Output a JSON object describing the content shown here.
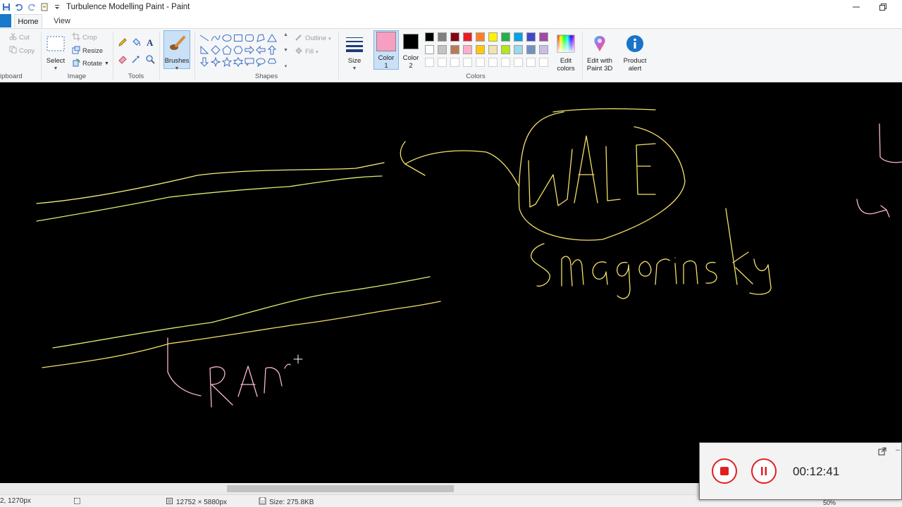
{
  "window": {
    "title": "Turbulence Modelling Paint - Paint"
  },
  "tabs": [
    {
      "label": "Home"
    },
    {
      "label": "View"
    }
  ],
  "ribbon": {
    "clipboard": {
      "group_label": "ipboard",
      "cut": "Cut",
      "copy": "Copy"
    },
    "image": {
      "group_label": "Image",
      "select": "Select",
      "crop": "Crop",
      "resize": "Resize",
      "rotate": "Rotate"
    },
    "tools": {
      "group_label": "Tools"
    },
    "brushes": {
      "label": "Brushes"
    },
    "shapes": {
      "group_label": "Shapes",
      "outline": "Outline",
      "fill": "Fill"
    },
    "size": {
      "label": "Size"
    },
    "color1": {
      "label_line1": "Color",
      "label_line2": "1",
      "value": "#f89ec2"
    },
    "color2": {
      "label_line1": "Color",
      "label_line2": "2",
      "value": "#000000"
    },
    "colors": {
      "group_label": "Colors",
      "row1": [
        "#000000",
        "#7f7f7f",
        "#880015",
        "#ed1c24",
        "#ff7f27",
        "#fff200",
        "#22b14c",
        "#00a2e8",
        "#3f48cc",
        "#a349a4"
      ],
      "row2": [
        "#ffffff",
        "#c3c3c3",
        "#b97a57",
        "#ffaec9",
        "#ffc90e",
        "#efe4b0",
        "#b5e61d",
        "#99d9ea",
        "#7092be",
        "#c8bfe7"
      ],
      "row3": [
        "#ffffff",
        "#ffffff",
        "#ffffff",
        "#ffffff",
        "#ffffff",
        "#ffffff",
        "#ffffff",
        "#ffffff",
        "#ffffff",
        "#ffffff"
      ]
    },
    "edit_colors": {
      "line1": "Edit",
      "line2": "colors"
    },
    "paint3d": {
      "line1": "Edit with",
      "line2": "Paint 3D"
    },
    "product_alert": {
      "line1": "Product",
      "line2": "alert"
    }
  },
  "canvas": {
    "ink_colors": {
      "yellow": "#f3f07a",
      "green_yellow": "#d9ef6e",
      "yellow2": "#f4e066",
      "pink": "#f7b6cf"
    }
  },
  "status": {
    "cursor_pos": "2, 1270px",
    "canvas_size": "12752 × 5880px",
    "file_size": "Size: 275.8KB",
    "zoom": "50%"
  },
  "recorder": {
    "timer": "00:12:41"
  }
}
